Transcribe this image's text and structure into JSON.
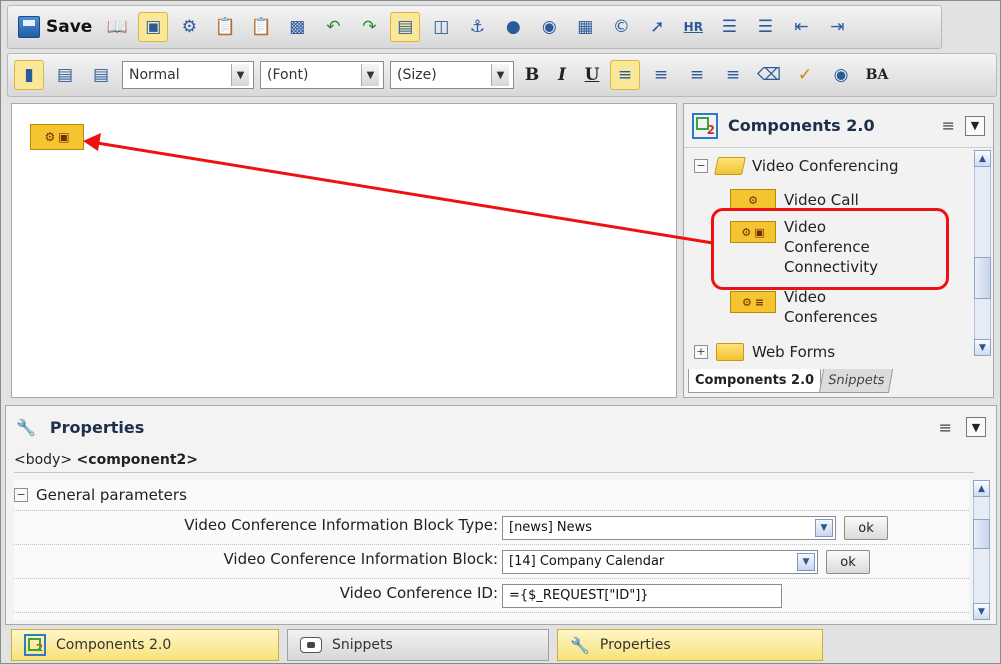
{
  "toolbar1": {
    "save_label": "Save",
    "icons": [
      "open-book-icon",
      "layout-icon",
      "gear-icon",
      "paste-word-icon",
      "paste-text-icon",
      "image-box-icon",
      "undo-icon",
      "redo-icon",
      "insert-line-icon",
      "table-icon",
      "anchor-icon",
      "users-icon",
      "users-add-icon",
      "picture-icon",
      "copyright-icon",
      "compass-icon",
      "hr-icon",
      "ordered-list-icon",
      "unordered-list-icon",
      "outdent-icon",
      "indent-icon"
    ],
    "hr_text": "HR"
  },
  "toolbar2": {
    "format_value": "Normal",
    "font_value": "(Font)",
    "size_value": "(Size)",
    "bold": "B",
    "italic": "I",
    "underline": "U",
    "ba": "BA"
  },
  "components_panel": {
    "title": "Components 2.0",
    "tree": {
      "folder_video": "Video Conferencing",
      "item_call": "Video Call",
      "item_connectivity_1": "Video",
      "item_connectivity_2": "Conference",
      "item_connectivity_3": "Connectivity",
      "item_conferences_1": "Video",
      "item_conferences_2": "Conferences",
      "folder_web": "Web Forms"
    },
    "tab_active": "Components 2.0",
    "tab_inactive": "Snippets"
  },
  "properties": {
    "title": "Properties",
    "breadcrumb_body": "<body>",
    "breadcrumb_component": "<component2>",
    "group": "General parameters",
    "rows": [
      {
        "label": "Video Conference Information Block Type:",
        "value": "[news] News",
        "ok": "ok"
      },
      {
        "label": "Video Conference Information Block:",
        "value": "[14] Company Calendar",
        "ok": "ok"
      },
      {
        "label": "Video Conference ID:",
        "value": "={$_REQUEST[\"ID\"]}"
      }
    ]
  },
  "bottom_tabs": {
    "components": "Components 2.0",
    "snippets": "Snippets",
    "properties": "Properties"
  },
  "colors": {
    "highlight": "#e11",
    "component_chip": "#f5c431"
  }
}
